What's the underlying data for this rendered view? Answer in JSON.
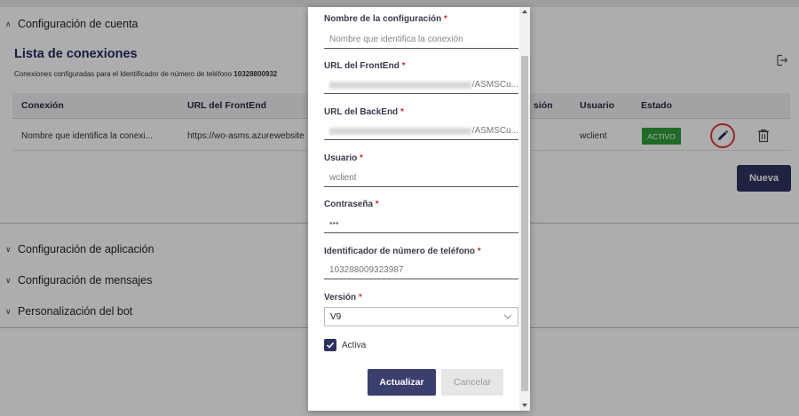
{
  "accordion": {
    "account": "Configuración de cuenta",
    "application": "Configuración de aplicación",
    "messages": "Configuración de mensajes",
    "bot": "Personalización del bot"
  },
  "connections": {
    "title": "Lista de conexiones",
    "subtitle_prefix": "Conexiones configuradas para el Identificador de número de teléfono",
    "subtitle_phone": "10328800932",
    "columns": [
      "Conexión",
      "URL del FrontEnd",
      "Versión",
      "Usuario",
      "Estado"
    ],
    "columns_visible": {
      "connection": "Conexión",
      "frontend": "URL del FrontEnd",
      "version_tail": "sión",
      "user": "Usuario",
      "status": "Estado"
    },
    "row": {
      "connection": "Nombre que identifica la conexi...",
      "frontend": "https://wo-asms.azurewebsite",
      "user": "wclient",
      "status": "ACTIVO"
    },
    "new_button": "Nueva"
  },
  "modal": {
    "name_label": "Nombre de la configuración",
    "name_placeholder": "Nombre que identifica la conexión",
    "frontend_label": "URL del FrontEnd",
    "frontend_suffix": "/ASMSCu...",
    "backend_label": "URL del BackEnd",
    "backend_suffix": "/ASMSCu...",
    "user_label": "Usuario",
    "user_value": "wclient",
    "password_label": "Contraseña",
    "password_value": "•••",
    "phone_label": "Identificador de número de teléfono",
    "phone_value": "103288009323987",
    "version_label": "Versión",
    "version_value": "V9",
    "active_label": "Activa",
    "active_checked": true,
    "required_mark": "*",
    "update_button": "Actualizar",
    "cancel_button": "Cancelar"
  },
  "colors": {
    "primary": "#2f3360",
    "status_active": "#2e9c3a",
    "highlight_ring": "#e53935",
    "required": "#d32f2f"
  }
}
